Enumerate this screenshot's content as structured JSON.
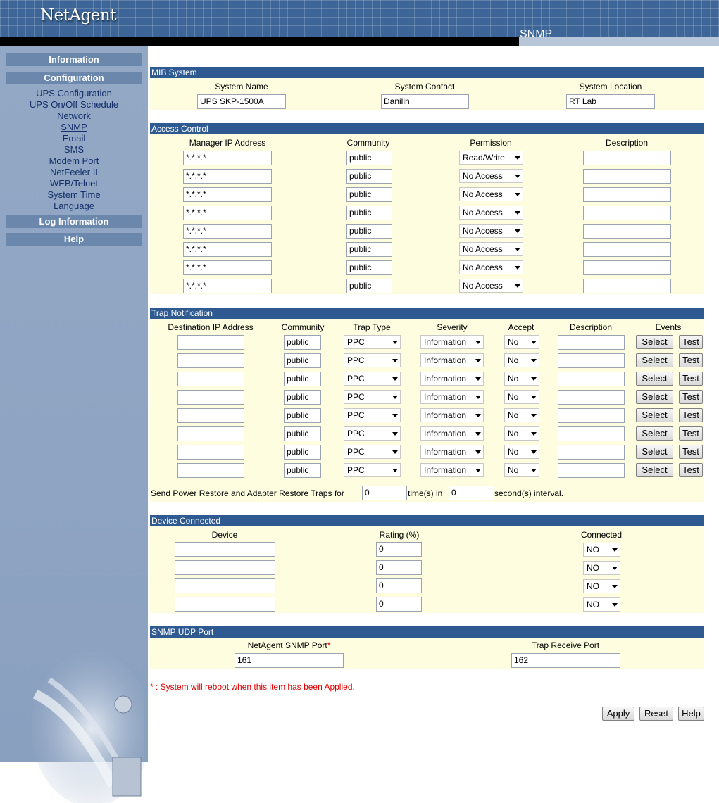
{
  "header": {
    "logo": "NetAgent",
    "page_name": "SNMP"
  },
  "sidebar": {
    "heads": [
      "Information",
      "Configuration",
      "Log Information",
      "Help"
    ],
    "links": [
      "UPS Configuration",
      "UPS On/Off Schedule",
      "Network",
      "SNMP",
      "Email",
      "SMS",
      "Modem Port",
      "NetFeeler II",
      "WEB/Telnet",
      "System Time",
      "Language"
    ],
    "current": "SNMP"
  },
  "mib": {
    "title": "MIB System",
    "headers": [
      "System Name",
      "System Contact",
      "System Location"
    ],
    "values": [
      "UPS SKP-1500A",
      "Danilin",
      "RT Lab"
    ]
  },
  "access": {
    "title": "Access Control",
    "headers": [
      "Manager IP Address",
      "Community",
      "Permission",
      "Description"
    ],
    "rows": [
      {
        "ip": "*.*.*.*",
        "community": "public",
        "permission": "Read/Write",
        "description": ""
      },
      {
        "ip": "*.*.*.*",
        "community": "public",
        "permission": "No Access",
        "description": ""
      },
      {
        "ip": "*.*.*.*",
        "community": "public",
        "permission": "No Access",
        "description": ""
      },
      {
        "ip": "*.*.*.*",
        "community": "public",
        "permission": "No Access",
        "description": ""
      },
      {
        "ip": "*.*.*.*",
        "community": "public",
        "permission": "No Access",
        "description": ""
      },
      {
        "ip": "*.*.*.*",
        "community": "public",
        "permission": "No Access",
        "description": ""
      },
      {
        "ip": "*.*.*.*",
        "community": "public",
        "permission": "No Access",
        "description": ""
      },
      {
        "ip": "*.*.*.*",
        "community": "public",
        "permission": "No Access",
        "description": ""
      }
    ]
  },
  "trap": {
    "title": "Trap Notification",
    "headers": [
      "Destination IP Address",
      "Community",
      "Trap Type",
      "Severity",
      "Accept",
      "Description",
      "Events"
    ],
    "rows": [
      {
        "ip": "",
        "community": "public",
        "type": "PPC",
        "severity": "Information",
        "accept": "No",
        "description": ""
      },
      {
        "ip": "",
        "community": "public",
        "type": "PPC",
        "severity": "Information",
        "accept": "No",
        "description": ""
      },
      {
        "ip": "",
        "community": "public",
        "type": "PPC",
        "severity": "Information",
        "accept": "No",
        "description": ""
      },
      {
        "ip": "",
        "community": "public",
        "type": "PPC",
        "severity": "Information",
        "accept": "No",
        "description": ""
      },
      {
        "ip": "",
        "community": "public",
        "type": "PPC",
        "severity": "Information",
        "accept": "No",
        "description": ""
      },
      {
        "ip": "",
        "community": "public",
        "type": "PPC",
        "severity": "Information",
        "accept": "No",
        "description": ""
      },
      {
        "ip": "",
        "community": "public",
        "type": "PPC",
        "severity": "Information",
        "accept": "No",
        "description": ""
      },
      {
        "ip": "",
        "community": "public",
        "type": "PPC",
        "severity": "Information",
        "accept": "No",
        "description": ""
      }
    ],
    "select_label": "Select",
    "test_label": "Test",
    "restore_prefix": "Send Power Restore and Adapter Restore Traps for",
    "restore_times": "0",
    "restore_mid": "time(s) in",
    "restore_seconds": "0",
    "restore_suffix": "second(s) interval."
  },
  "device": {
    "title": "Device Connected",
    "headers": [
      "Device",
      "Rating (%)",
      "Connected"
    ],
    "rows": [
      {
        "device": "",
        "rating": "0",
        "connected": "NO"
      },
      {
        "device": "",
        "rating": "0",
        "connected": "NO"
      },
      {
        "device": "",
        "rating": "0",
        "connected": "NO"
      },
      {
        "device": "",
        "rating": "0",
        "connected": "NO"
      }
    ]
  },
  "udp": {
    "title": "SNMP UDP Port",
    "headers": [
      "NetAgent SNMP Port",
      "Trap Receive Port"
    ],
    "star": "*",
    "values": [
      "161",
      "162"
    ]
  },
  "note": {
    "star": "*",
    "text": " : System will reboot when this item has been Applied."
  },
  "buttons": {
    "apply": "Apply",
    "reset": "Reset",
    "help": "Help"
  },
  "colors": {
    "section_bar": "#2f5a91",
    "section_bg": "#fffde0",
    "sidebar": "#92a8c5",
    "note": "#e00000"
  }
}
